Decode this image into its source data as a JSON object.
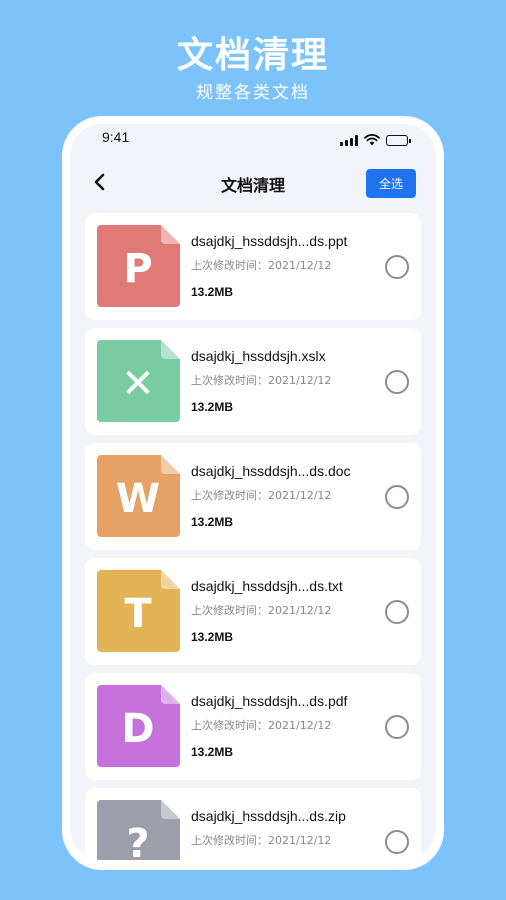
{
  "promo": {
    "title": "文档清理",
    "subtitle": "规整各类文档"
  },
  "status_bar": {
    "time": "9:41"
  },
  "nav": {
    "title": "文档清理",
    "select_all_label": "全选",
    "back_icon": "chevron-left-icon"
  },
  "files": [
    {
      "name": "dsajdkj_hssddsjh...ds.ppt",
      "modified": "上次修改时间：2021/12/12",
      "size": "13.2MB",
      "icon_letter": "P",
      "icon_color": "#e07a77",
      "icon": "ppt-file-icon"
    },
    {
      "name": "dsajdkj_hssddsjh.xslx",
      "modified": "上次修改时间：2021/12/12",
      "size": "13.2MB",
      "icon_letter": "✕",
      "icon_color": "#79cba4",
      "icon": "excel-file-icon"
    },
    {
      "name": "dsajdkj_hssddsjh...ds.doc",
      "modified": "上次修改时间：2021/12/12",
      "size": "13.2MB",
      "icon_letter": "W",
      "icon_color": "#e6a265",
      "icon": "word-file-icon"
    },
    {
      "name": "dsajdkj_hssddsjh...ds.txt",
      "modified": "上次修改时间：2021/12/12",
      "size": "13.2MB",
      "icon_letter": "T",
      "icon_color": "#e2b455",
      "icon": "txt-file-icon"
    },
    {
      "name": "dsajdkj_hssddsjh...ds.pdf",
      "modified": "上次修改时间：2021/12/12",
      "size": "13.2MB",
      "icon_letter": "D",
      "icon_color": "#c572dc",
      "icon": "pdf-file-icon"
    },
    {
      "name": "dsajdkj_hssddsjh...ds.zip",
      "modified": "上次修改时间：2021/12/12",
      "size": "",
      "icon_letter": "?",
      "icon_color": "#9c9ea9",
      "icon": "unknown-file-icon"
    }
  ]
}
